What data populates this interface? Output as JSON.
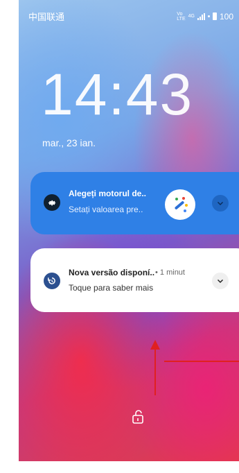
{
  "status_bar": {
    "carrier": "中国联通",
    "volte_top": "Vo",
    "volte_bottom": "LTE",
    "network": "4G",
    "battery": "100"
  },
  "lockscreen": {
    "time": "14:43",
    "date": "mar., 23 ian."
  },
  "notifications": [
    {
      "title": "Alegeți motorul de..",
      "subtitle": "Setați valoarea pre..",
      "icon": "gear-icon",
      "thumbnail": "magic-wand-icon",
      "bg": "#2f80e6"
    },
    {
      "title": "Nova versão disponí..",
      "time": "• 1 minut",
      "subtitle": "Toque para saber mais",
      "icon": "update-icon",
      "bg": "#ffffff"
    }
  ],
  "accent_red": "#e02020"
}
